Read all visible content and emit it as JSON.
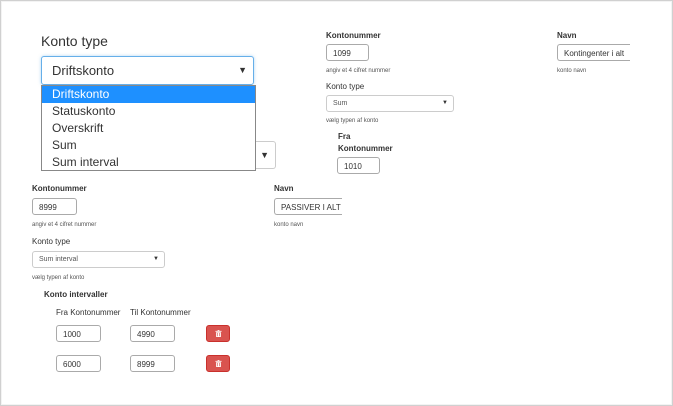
{
  "top_left": {
    "title": "Konto type",
    "select_value": "Driftskonto",
    "options": [
      "Driftskonto",
      "Statuskonto",
      "Overskrift",
      "Sum",
      "Sum interval"
    ]
  },
  "top_mid": {
    "kontonummer_label": "Kontonummer",
    "kontonummer_value": "1099",
    "kontonummer_help": "angiv et 4 cifret nummer",
    "kontotype_label": "Konto type",
    "kontotype_value": "Sum",
    "kontotype_help": "vælg typen af konto",
    "fra_label_1": "Fra",
    "fra_label_2": "Kontonummer",
    "fra_value": "1010"
  },
  "top_right": {
    "navn_label": "Navn",
    "navn_value": "Kontingenter i alt",
    "navn_help": "konto navn"
  },
  "second": {
    "kontonummer_label": "Kontonummer",
    "kontonummer_value": "8999",
    "kontonummer_help": "angiv et 4 cifret nummer",
    "navn_label": "Navn",
    "navn_value": "PASSIVER I ALT",
    "navn_help": "konto navn",
    "kontotype_label": "Konto type",
    "kontotype_value": "Sum interval",
    "kontotype_help": "vælg typen af konto"
  },
  "intervals": {
    "title": "Konto intervaller",
    "fra_header": "Fra Kontonummer",
    "til_header": "Til Kontonummer",
    "rows": [
      {
        "fra": "1000",
        "til": "4990"
      },
      {
        "fra": "6000",
        "til": "8999"
      }
    ]
  },
  "colors": {
    "selected_option": "#1e90ff",
    "delete_button": "#d9534f",
    "focus_border": "#66afe9"
  }
}
